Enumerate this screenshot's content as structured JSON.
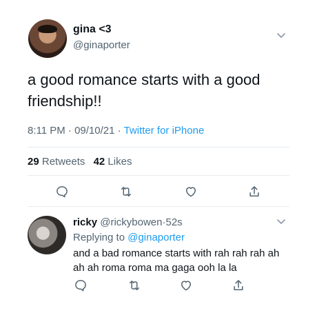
{
  "tweet": {
    "display_name": "gina <3",
    "handle": "@ginaporter",
    "text": "a good romance starts with a good friendship!!",
    "time": "8:11 PM",
    "sep": "·",
    "date": "09/10/21",
    "source": "Twitter for iPhone",
    "retweets_count": "29",
    "retweets_label": "Retweets",
    "likes_count": "42",
    "likes_label": "Likes"
  },
  "reply": {
    "display_name": "ricky",
    "handle": "@rickybowen",
    "sep": "·",
    "time": "52s",
    "replying_prefix": "Replying to",
    "replying_to": "@ginaporter",
    "text": "and a bad romance starts with rah rah rah ah ah ah roma roma ma gaga ooh la la"
  },
  "icons": {
    "reply": "reply-icon",
    "retweet": "retweet-icon",
    "like": "heart-icon",
    "share": "share-icon",
    "more": "chevron-down-icon"
  },
  "colors": {
    "text": "#0f1419",
    "secondary": "#536471",
    "link": "#1d9bf0",
    "divider": "#e6ecf0"
  }
}
